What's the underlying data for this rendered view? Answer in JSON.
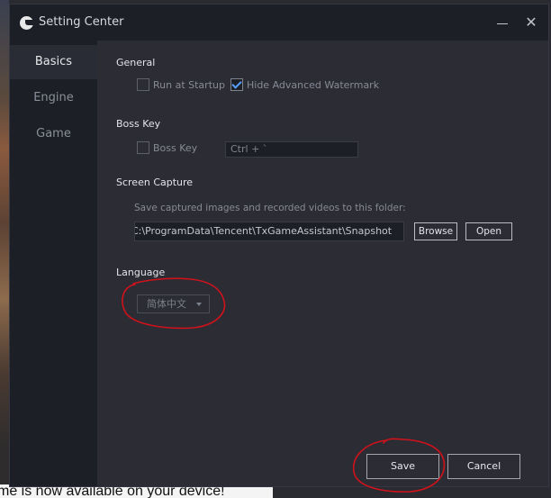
{
  "background": {
    "bottom_text": "me is now available on your device!"
  },
  "window": {
    "title": "Setting Center",
    "close_glyph": "✕"
  },
  "sidebar": {
    "items": [
      {
        "label": "Basics",
        "active": true
      },
      {
        "label": "Engine",
        "active": false
      },
      {
        "label": "Game",
        "active": false
      }
    ]
  },
  "general": {
    "title": "General",
    "run_at_startup": {
      "label": "Run at Startup",
      "checked": false
    },
    "hide_watermark": {
      "label": "Hide Advanced Watermark",
      "checked": true
    }
  },
  "boss_key": {
    "title": "Boss Key",
    "checkbox": {
      "label": "Boss Key",
      "checked": false
    },
    "shortcut_value": "Ctrl + `"
  },
  "screen_capture": {
    "title": "Screen Capture",
    "hint": "Save captured images and recorded videos to this folder:",
    "path_value": "C:\\ProgramData\\Tencent\\TxGameAssistant\\Snapshot",
    "browse_label": "Browse",
    "open_label": "Open"
  },
  "language": {
    "title": "Language",
    "selected": "简体中文"
  },
  "footer": {
    "save_label": "Save",
    "cancel_label": "Cancel"
  },
  "colors": {
    "annotation": "#d0121b",
    "checkbox_accent": "#56a1ff"
  }
}
